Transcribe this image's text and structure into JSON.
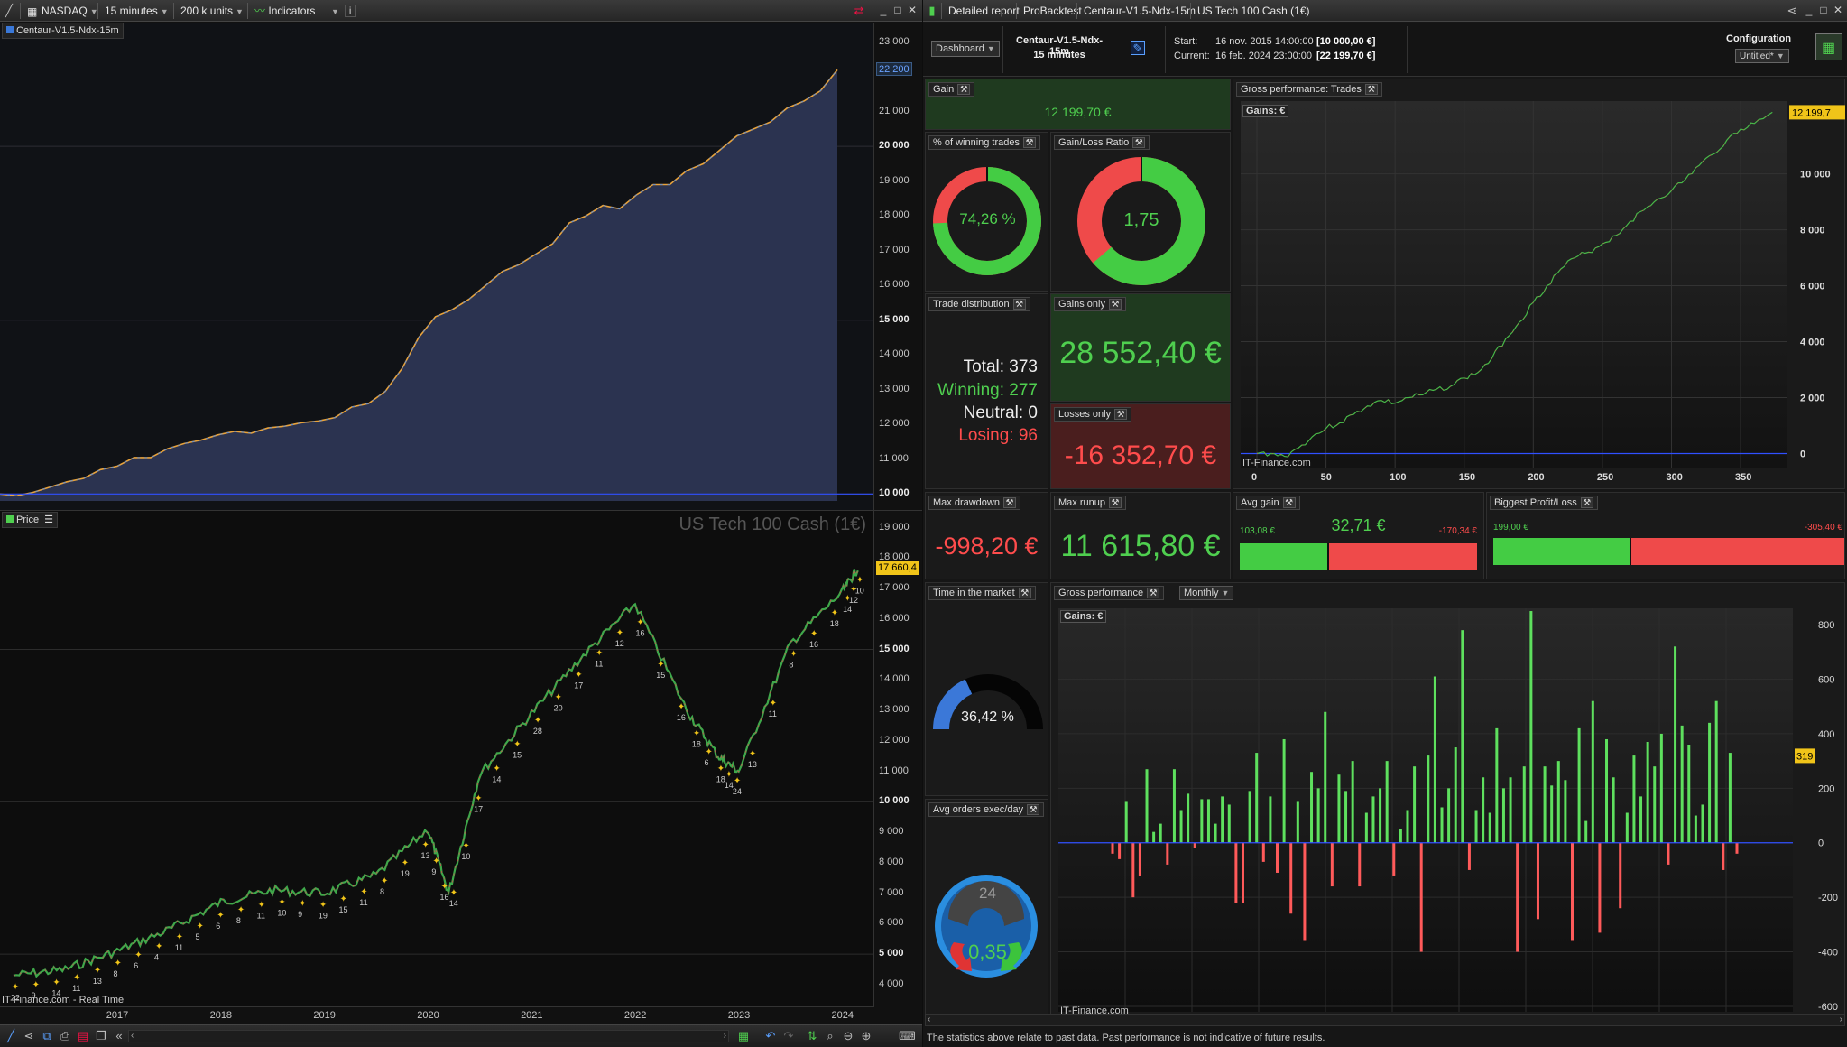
{
  "left": {
    "toolbar": {
      "market": "NASDAQ",
      "timeframe": "15 minutes",
      "units": "200 k units",
      "indicators": "Indicators",
      "info": "i"
    },
    "equity_panel": {
      "label": "Centaur-V1.5-Ndx-15m",
      "last_value": "22 200",
      "y_ticks": [
        "23 000",
        "22 200",
        "21 000",
        "20 000",
        "19 000",
        "18 000",
        "17 000",
        "16 000",
        "15 000",
        "14 000",
        "13 000",
        "12 000",
        "11 000",
        "10 000"
      ]
    },
    "price_panel": {
      "label": "Price",
      "instrument_watermark": "US Tech 100 Cash (1€)",
      "last_value": "17 660,4",
      "y_ticks": [
        "19 000",
        "18 000",
        "17 000",
        "16 000",
        "15 000",
        "14 000",
        "13 000",
        "12 000",
        "11 000",
        "10 000",
        "9 000",
        "8 000",
        "7 000",
        "6 000",
        "5 000",
        "4 000"
      ],
      "x_ticks": [
        "2017",
        "2018",
        "2019",
        "2020",
        "2021",
        "2022",
        "2023",
        "2024"
      ],
      "footer": "IT-Finance.com - Real Time",
      "trade_labels": [
        "22",
        "9",
        "14",
        "11",
        "13",
        "8",
        "6",
        "4",
        "11",
        "5",
        "6",
        "8",
        "11",
        "10",
        "9",
        "19",
        "15",
        "11",
        "8",
        "19",
        "13",
        "9",
        "16",
        "14",
        "10",
        "17",
        "14",
        "15",
        "28",
        "20",
        "17",
        "11",
        "12",
        "16",
        "15",
        "16",
        "18",
        "6",
        "18",
        "14",
        "24",
        "13",
        "11",
        "8",
        "16",
        "18",
        "14",
        "12",
        "10"
      ]
    }
  },
  "right": {
    "toolbar": {
      "tabs": [
        "Detailed report",
        "ProBacktest",
        "Centaur-V1.5-Ndx-15m",
        "US Tech 100 Cash (1€)"
      ]
    },
    "header": {
      "dashboard": "Dashboard",
      "system_name": "Centaur-V1.5-Ndx-15m",
      "system_tf": "15 minutes",
      "start_label": "Start:",
      "start_date": "16 nov. 2015 14:00:00",
      "start_value": "[10 000,00 €]",
      "current_label": "Current:",
      "current_date": "16 feb. 2024 23:00:00",
      "current_value": "[22 199,70 €]",
      "configuration": "Configuration",
      "config_name": "Untitled*"
    },
    "gain": {
      "title": "Gain",
      "value": "12 199,70 €"
    },
    "winning_pct": {
      "title": "% of winning trades",
      "value": "74,26 %",
      "fraction": 0.7426
    },
    "gl_ratio": {
      "title": "Gain/Loss Ratio",
      "value": "1,75",
      "fraction": 0.636
    },
    "distribution": {
      "title": "Trade distribution",
      "total": "Total: 373",
      "winning": "Winning: 277",
      "neutral": "Neutral: 0",
      "losing": "Losing: 96"
    },
    "gains_only": {
      "title": "Gains only",
      "value": "28 552,40 €"
    },
    "losses_only": {
      "title": "Losses only",
      "value": "-16 352,70 €"
    },
    "max_drawdown": {
      "title": "Max drawdown",
      "value": "-998,20 €"
    },
    "max_runup": {
      "title": "Max runup",
      "value": "11 615,80 €"
    },
    "avg_gain": {
      "title": "Avg gain",
      "value": "32,71 €",
      "left": "103,08 €",
      "right": "-170,34 €",
      "fraction": 0.377
    },
    "biggest": {
      "title": "Biggest Profit/Loss",
      "left": "199,00 €",
      "right": "-305,40 €",
      "fraction": 0.394
    },
    "time_market": {
      "title": "Time in the market",
      "value": "36,42 %",
      "fraction": 0.3642
    },
    "avg_orders": {
      "title": "Avg orders exec/day",
      "value": "0,35",
      "hours": "24"
    },
    "trades_chart": {
      "title": "Gross performance: Trades",
      "legend": "Gains: €",
      "last_tag": "12 199,7",
      "watermark": "IT-Finance.com",
      "y_ticks": [
        "10 000",
        "8 000",
        "6 000",
        "4 000",
        "2 000",
        "0"
      ],
      "x_ticks": [
        "0",
        "50",
        "100",
        "150",
        "200",
        "250",
        "300",
        "350"
      ]
    },
    "monthly_chart": {
      "title": "Gross performance",
      "period": "Monthly",
      "legend": "Gains: €",
      "last_tag": "319",
      "watermark": "IT-Finance.com",
      "y_ticks": [
        "800",
        "600",
        "400",
        "200",
        "0",
        "-200",
        "-400",
        "-600"
      ]
    },
    "footer": "The statistics above relate to past data. Past performance is not indicative of future results."
  },
  "chart_data": [
    {
      "type": "area",
      "title": "Centaur-V1.5-Ndx-15m",
      "ylim": [
        9800,
        23300
      ],
      "x": [
        0,
        2,
        4,
        6,
        8,
        10,
        12,
        14,
        16,
        18,
        20,
        22,
        24,
        26,
        28,
        30,
        32,
        34,
        36,
        38,
        40,
        42,
        44,
        46,
        48,
        50,
        52,
        54,
        56,
        58,
        60,
        62,
        64,
        66,
        68,
        70,
        72,
        74,
        76,
        78,
        80,
        82,
        84,
        86,
        88,
        90,
        92,
        94,
        96,
        98,
        100
      ],
      "values": [
        10000,
        9950,
        10050,
        10200,
        10350,
        10450,
        10700,
        10800,
        11050,
        11050,
        11300,
        11450,
        11550,
        11700,
        11800,
        11750,
        11900,
        11950,
        12050,
        12100,
        12200,
        12500,
        12600,
        12950,
        13600,
        14500,
        15100,
        15300,
        15600,
        16000,
        16400,
        16600,
        16900,
        17200,
        17800,
        18000,
        18300,
        18200,
        18600,
        18900,
        18900,
        19300,
        19500,
        19900,
        20300,
        20500,
        20700,
        21100,
        21300,
        21600,
        22200
      ]
    },
    {
      "type": "line",
      "title": "US Tech 100 Cash (1€)",
      "ylim": [
        3700,
        19400
      ],
      "x": [
        "2016",
        "2016.5",
        "2017",
        "2017.5",
        "2018",
        "2018.5",
        "2019",
        "2019.5",
        "2020",
        "2020.2",
        "2020.5",
        "2021",
        "2021.5",
        "2022",
        "2022.5",
        "2022.8",
        "2023",
        "2023.5",
        "2024",
        "2024.15"
      ],
      "values": [
        4300,
        4500,
        5100,
        5800,
        6700,
        7100,
        7000,
        7600,
        9100,
        7000,
        10900,
        12900,
        14800,
        16500,
        13000,
        11500,
        11000,
        15200,
        16900,
        17660
      ]
    },
    {
      "type": "line",
      "title": "Gross performance: Trades",
      "ylim": [
        -500,
        12600
      ],
      "x": [
        0,
        10,
        20,
        30,
        40,
        50,
        60,
        70,
        80,
        90,
        100,
        110,
        120,
        130,
        140,
        150,
        160,
        170,
        180,
        190,
        200,
        210,
        220,
        230,
        240,
        250,
        260,
        270,
        280,
        290,
        300,
        310,
        320,
        330,
        340,
        350,
        360,
        373
      ],
      "values": [
        0,
        0,
        -100,
        200,
        600,
        900,
        1100,
        1400,
        1700,
        1900,
        1800,
        2000,
        2100,
        2300,
        2400,
        2700,
        2900,
        3400,
        4100,
        4700,
        5400,
        6000,
        6600,
        7000,
        7200,
        7500,
        7800,
        8300,
        8700,
        9100,
        9400,
        9800,
        10300,
        10700,
        11200,
        11600,
        11800,
        12199.7
      ]
    },
    {
      "type": "bar",
      "title": "Gross performance",
      "ylim": [
        -620,
        860
      ],
      "values": [
        -40,
        -60,
        150,
        -200,
        -120,
        270,
        40,
        70,
        -80,
        270,
        120,
        180,
        -20,
        160,
        160,
        70,
        170,
        140,
        -220,
        -220,
        190,
        330,
        -70,
        170,
        -110,
        380,
        -260,
        150,
        -360,
        260,
        200,
        480,
        -160,
        250,
        190,
        300,
        -160,
        110,
        170,
        200,
        300,
        -120,
        50,
        120,
        280,
        -400,
        320,
        610,
        130,
        200,
        350,
        780,
        -100,
        120,
        240,
        110,
        420,
        200,
        240,
        -400,
        280,
        850,
        -280,
        280,
        210,
        300,
        230,
        -360,
        420,
        80,
        520,
        -330,
        380,
        240,
        -240,
        110,
        320,
        170,
        370,
        280,
        400,
        -80,
        720,
        430,
        360,
        100,
        140,
        440,
        520,
        -100,
        330,
        -40
      ]
    }
  ]
}
